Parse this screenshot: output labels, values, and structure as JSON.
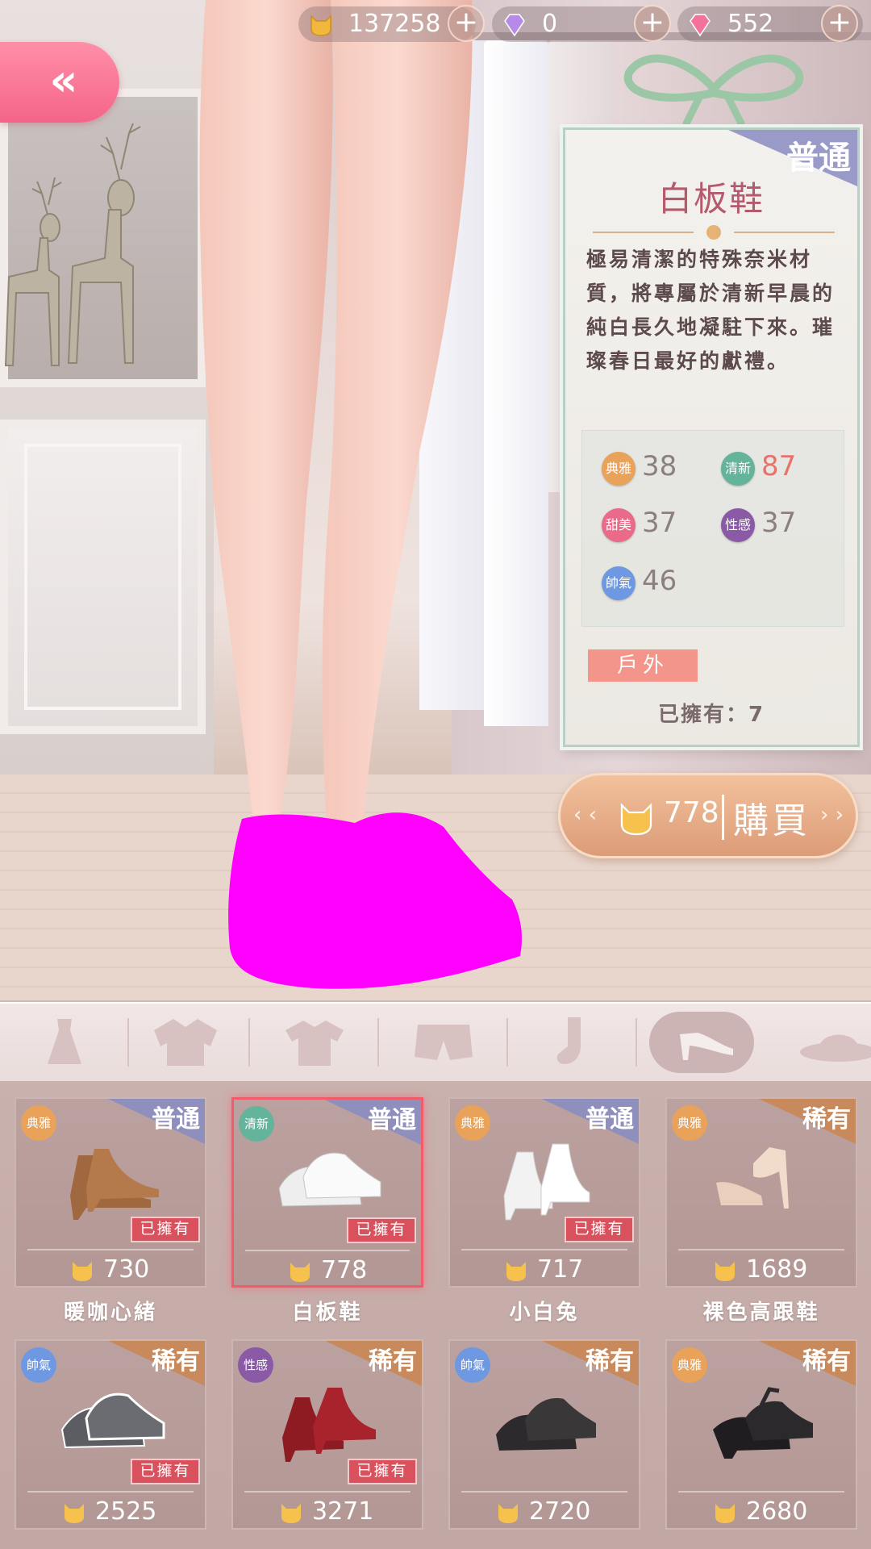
{
  "currency": {
    "gold": "137258",
    "diamond": "0",
    "pink_diamond": "552"
  },
  "detail": {
    "rarity": "普通",
    "title": "白板鞋",
    "description": "極易清潔的特殊奈米材質，將專屬於清新早晨的純白長久地凝駐下來。璀璨春日最好的獻禮。",
    "stats": [
      {
        "badge": "典雅",
        "value": "38",
        "kind": "elegant",
        "highlight": false
      },
      {
        "badge": "清新",
        "value": "87",
        "kind": "fresh",
        "highlight": true
      },
      {
        "badge": "甜美",
        "value": "37",
        "kind": "sweet",
        "highlight": false
      },
      {
        "badge": "性感",
        "value": "37",
        "kind": "sexy",
        "highlight": false
      },
      {
        "badge": "帥氣",
        "value": "46",
        "kind": "cool",
        "highlight": false
      }
    ],
    "tag": "戶外",
    "owned_text": "已擁有：7"
  },
  "buy": {
    "price": "778",
    "label": "購買"
  },
  "tabs": [
    "dress-icon",
    "jacket-icon",
    "shirt-icon",
    "shorts-icon",
    "sock-icon",
    "heel-shoe-icon",
    "hat-icon"
  ],
  "active_tab": 5,
  "items": [
    {
      "name": "暖咖心緒",
      "price": "730",
      "rarity": "普通",
      "style": "典雅",
      "owned": "已擁有"
    },
    {
      "name": "白板鞋",
      "price": "778",
      "rarity": "普通",
      "style": "清新",
      "owned": "已擁有"
    },
    {
      "name": "小白兔",
      "price": "717",
      "rarity": "普通",
      "style": "典雅",
      "owned": "已擁有"
    },
    {
      "name": "裸色高跟鞋",
      "price": "1689",
      "rarity": "稀有",
      "style": "典雅",
      "owned": ""
    },
    {
      "name": "",
      "price": "2525",
      "rarity": "稀有",
      "style": "帥氣",
      "owned": "已擁有"
    },
    {
      "name": "",
      "price": "3271",
      "rarity": "稀有",
      "style": "性感",
      "owned": "已擁有"
    },
    {
      "name": "",
      "price": "2720",
      "rarity": "稀有",
      "style": "帥氣",
      "owned": ""
    },
    {
      "name": "",
      "price": "2680",
      "rarity": "稀有",
      "style": "典雅",
      "owned": ""
    }
  ],
  "colors": {
    "accent_pink": "#f5648a",
    "selected_border": "#f15b6a",
    "stat_highlight": "#e9716c",
    "tag_outdoor": "#f3958a"
  }
}
